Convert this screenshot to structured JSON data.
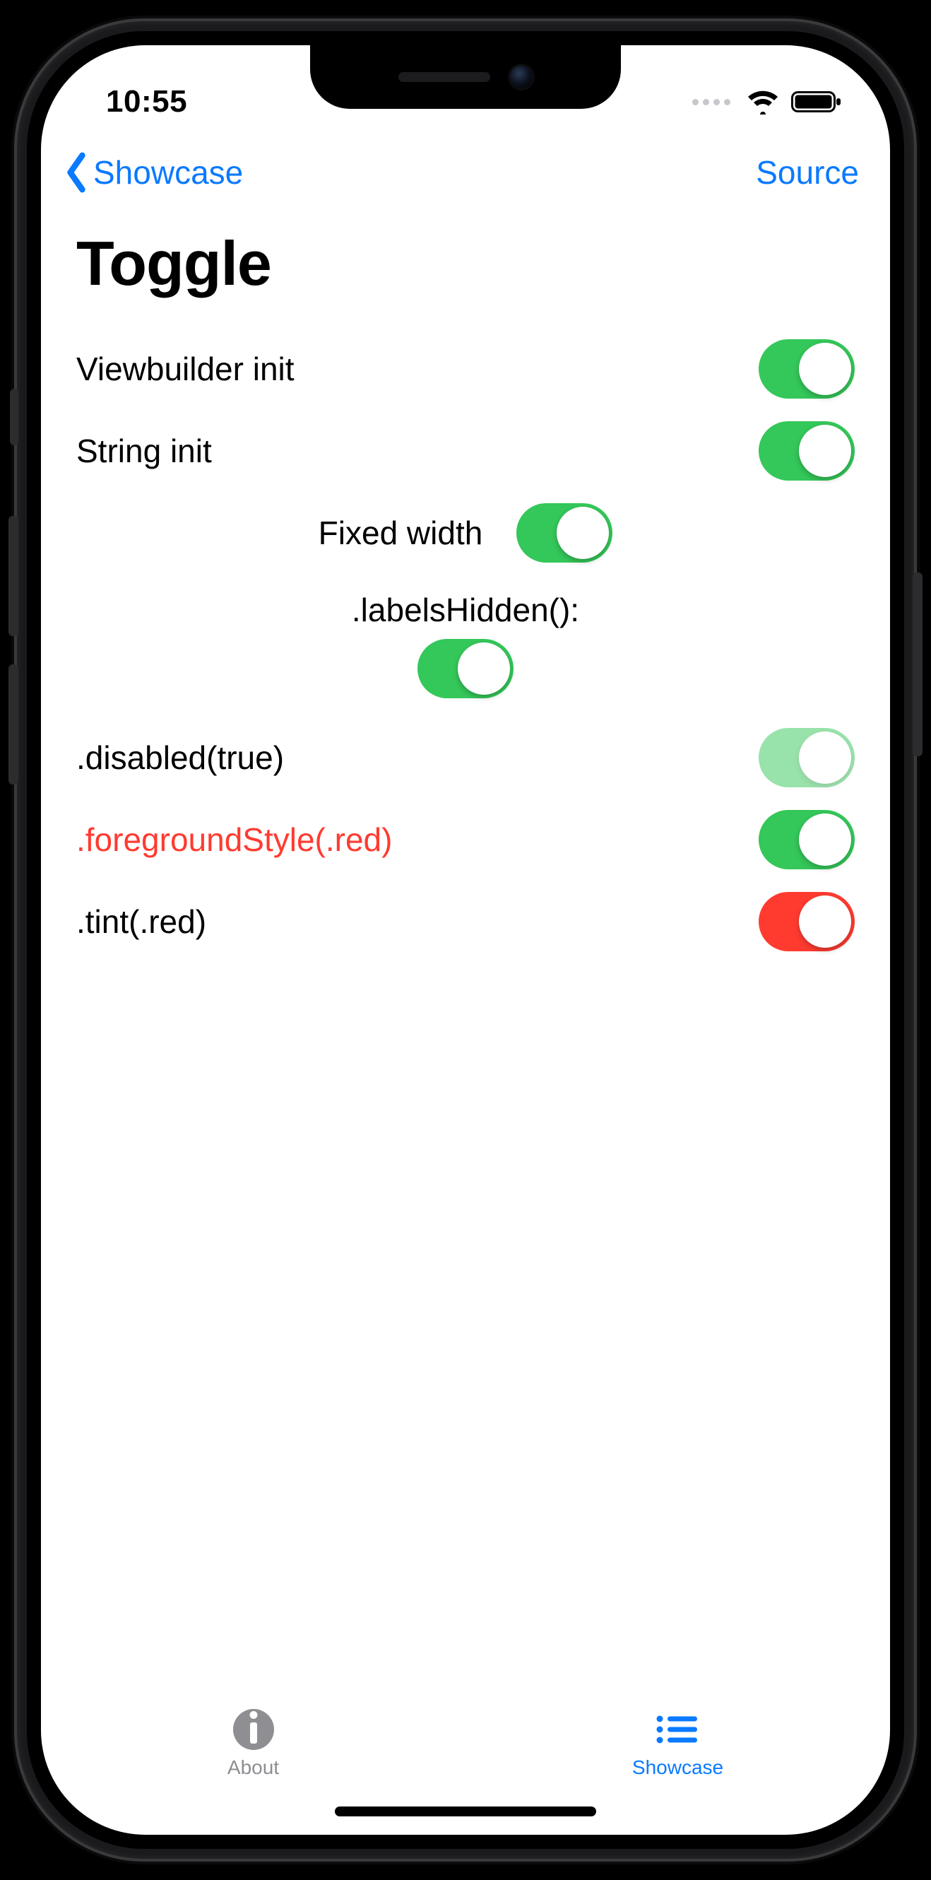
{
  "status": {
    "time": "10:55"
  },
  "nav": {
    "back_label": "Showcase",
    "trailing_label": "Source"
  },
  "title": "Toggle",
  "rows": {
    "viewbuilder": {
      "label": "Viewbuilder init",
      "on": true
    },
    "string": {
      "label": "String init",
      "on": true
    },
    "fixed": {
      "label": "Fixed width",
      "on": true
    },
    "labels_hidden_caption": ".labelsHidden():",
    "labels_hidden": {
      "on": true
    },
    "disabled": {
      "label": ".disabled(true)",
      "on": true
    },
    "foreground": {
      "label": ".foregroundStyle(.red)",
      "on": true
    },
    "tint": {
      "label": ".tint(.red)",
      "on": true
    }
  },
  "tabs": {
    "about": {
      "label": "About",
      "active": false
    },
    "showcase": {
      "label": "Showcase",
      "active": true
    }
  },
  "colors": {
    "accent": "#0a7aff",
    "switch_green": "#34c759",
    "red": "#ff3b30",
    "inactive": "#8e8e93"
  }
}
